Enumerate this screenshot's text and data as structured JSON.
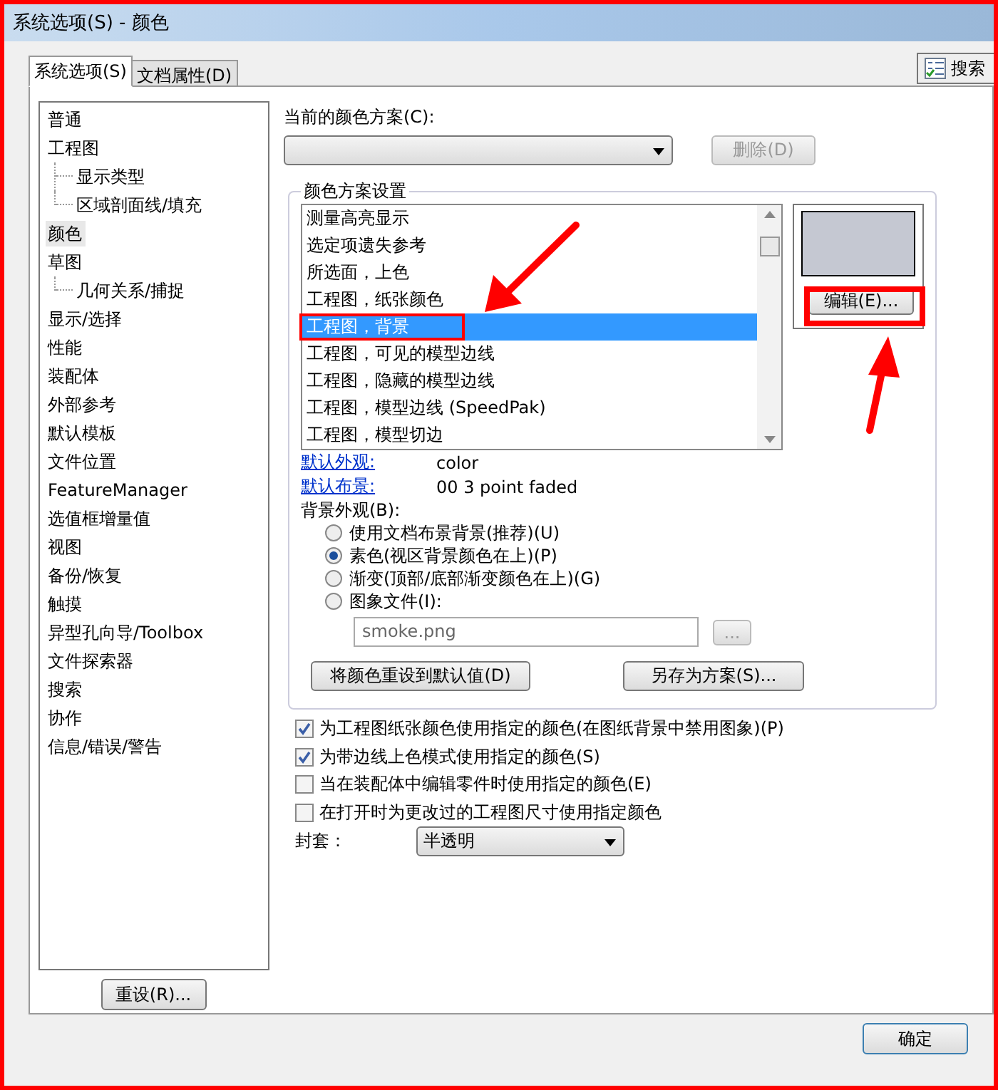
{
  "window": {
    "title": "系统选项(S) - 颜色"
  },
  "tabs": [
    {
      "label": "系统选项(S)",
      "selected": true
    },
    {
      "label": "文档属性(D)",
      "selected": false
    }
  ],
  "search_button": {
    "label": "搜索"
  },
  "sidebar": {
    "items": [
      {
        "label": "普通",
        "selected": false
      },
      {
        "label": "工程图",
        "selected": false,
        "children": [
          {
            "label": "显示类型",
            "selected": false
          },
          {
            "label": "区域剖面线/填充",
            "selected": false
          }
        ]
      },
      {
        "label": "颜色",
        "selected": true
      },
      {
        "label": "草图",
        "selected": false,
        "children": [
          {
            "label": "几何关系/捕捉",
            "selected": false
          }
        ]
      },
      {
        "label": "显示/选择",
        "selected": false
      },
      {
        "label": "性能",
        "selected": false
      },
      {
        "label": "装配体",
        "selected": false
      },
      {
        "label": "外部参考",
        "selected": false
      },
      {
        "label": "默认模板",
        "selected": false
      },
      {
        "label": "文件位置",
        "selected": false
      },
      {
        "label": "FeatureManager",
        "selected": false
      },
      {
        "label": "选值框增量值",
        "selected": false
      },
      {
        "label": "视图",
        "selected": false
      },
      {
        "label": "备份/恢复",
        "selected": false
      },
      {
        "label": "触摸",
        "selected": false
      },
      {
        "label": "异型孔向导/Toolbox",
        "selected": false
      },
      {
        "label": "文件探索器",
        "selected": false
      },
      {
        "label": "搜索",
        "selected": false
      },
      {
        "label": "协作",
        "selected": false
      },
      {
        "label": "信息/错误/警告",
        "selected": false
      }
    ]
  },
  "reset_button": {
    "label": "重设(R)..."
  },
  "color_scheme": {
    "label": "当前的颜色方案(C):",
    "delete_button": {
      "label": "删除(D)",
      "disabled": true
    }
  },
  "scheme_settings": {
    "title": "颜色方案设置",
    "items": [
      {
        "label": "测量高亮显示",
        "selected": false
      },
      {
        "label": "选定项遗失参考",
        "selected": false
      },
      {
        "label": "所选面，上色",
        "selected": false
      },
      {
        "label": "工程图，纸张颜色",
        "selected": false
      },
      {
        "label": "工程图，背景",
        "selected": true
      },
      {
        "label": "工程图，可见的模型边线",
        "selected": false
      },
      {
        "label": "工程图，隐藏的模型边线",
        "selected": false
      },
      {
        "label": "工程图，模型边线 (SpeedPak)",
        "selected": false
      },
      {
        "label": "工程图，模型切边",
        "selected": false
      }
    ],
    "edit_button": {
      "label": "编辑(E)..."
    },
    "defaults": [
      {
        "label": "默认外观:",
        "value": "color"
      },
      {
        "label": "默认布景:",
        "value": "00 3 point faded"
      }
    ],
    "background": {
      "label": "背景外观(B):",
      "options": [
        {
          "label": "使用文档布景背景(推荐)(U)",
          "selected": false
        },
        {
          "label": "素色(视区背景颜色在上)(P)",
          "selected": true
        },
        {
          "label": "渐变(顶部/底部渐变颜色在上)(G)",
          "selected": false
        },
        {
          "label": "图象文件(I):",
          "selected": false
        }
      ],
      "file_field": {
        "value": "smoke.png",
        "disabled": true
      },
      "browse_button": {
        "label": "...",
        "disabled": true
      }
    },
    "reset_colors_button": {
      "label": "将颜色重设到默认值(D)"
    },
    "save_as_button": {
      "label": "另存为方案(S)..."
    }
  },
  "checkboxes": [
    {
      "label": "为工程图纸张颜色使用指定的颜色(在图纸背景中禁用图象)(P)",
      "checked": true
    },
    {
      "label": "为带边线上色模式使用指定的颜色(S)",
      "checked": true
    },
    {
      "label": "当在装配体中编辑零件时使用指定的颜色(E)",
      "checked": false
    },
    {
      "label": "在打开时为更改过的工程图尺寸使用指定颜色",
      "checked": false
    }
  ],
  "envelope": {
    "label": "封套：",
    "value": "半透明"
  },
  "ok_button": {
    "label": "确定"
  }
}
